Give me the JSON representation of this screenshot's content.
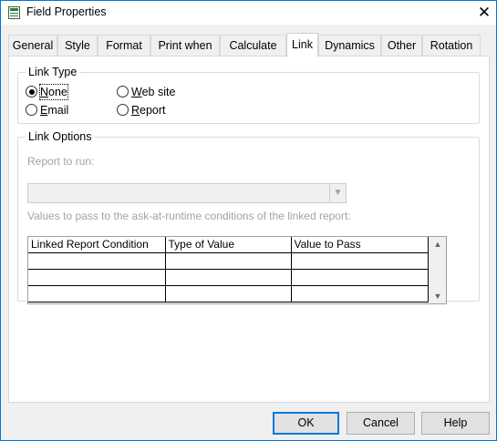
{
  "window": {
    "title": "Field Properties"
  },
  "tabs": [
    "General",
    "Style",
    "Format",
    "Print when",
    "Calculate",
    "Link",
    "Dynamics",
    "Other",
    "Rotation"
  ],
  "active_tab": "Link",
  "link_type": {
    "title": "Link Type",
    "options": [
      {
        "label": "None",
        "mnemonic": "N",
        "checked": true
      },
      {
        "label": "Web site",
        "mnemonic": "W",
        "checked": false
      },
      {
        "label": "Email",
        "mnemonic": "E",
        "checked": false
      },
      {
        "label": "Report",
        "mnemonic": "R",
        "checked": false
      }
    ]
  },
  "link_options": {
    "title": "Link Options",
    "report_label": "Report to run:",
    "report_value": "",
    "values_label": "Values to pass to the ask-at-runtime conditions of the linked report:",
    "columns": [
      "Linked Report Condition",
      "Type of Value",
      "Value to Pass"
    ],
    "rows": [
      [
        "",
        "",
        ""
      ],
      [
        "",
        "",
        ""
      ],
      [
        "",
        "",
        ""
      ]
    ]
  },
  "buttons": {
    "ok": "OK",
    "cancel": "Cancel",
    "help": "Help"
  },
  "colors": {
    "accent": "#0078d7",
    "disabled_text": "#a3a3a3",
    "button_face": "#e1e1e1"
  }
}
